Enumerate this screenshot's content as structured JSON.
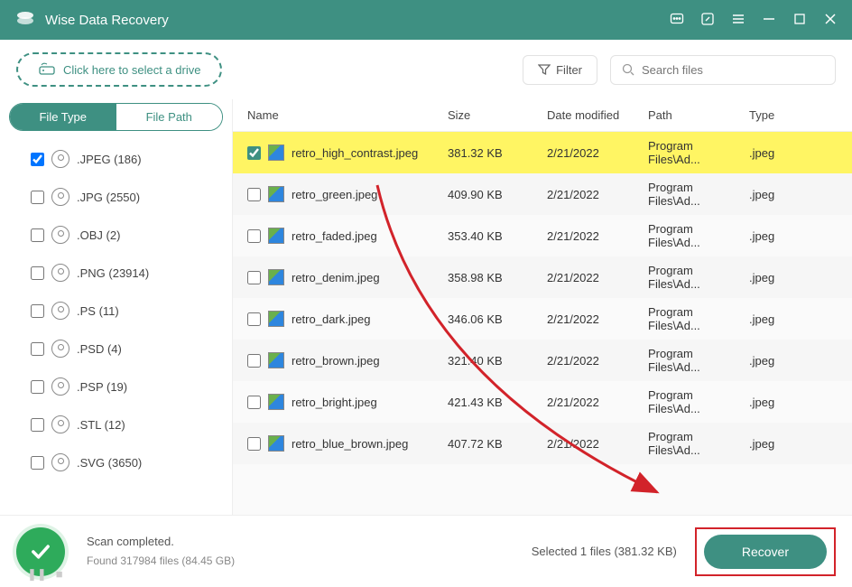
{
  "app": {
    "title": "Wise Data Recovery"
  },
  "topbar": {
    "drive_hint": "Click here to select a drive",
    "filter_label": "Filter",
    "search_placeholder": "Search files"
  },
  "tabs": {
    "file_type": "File Type",
    "file_path": "File Path"
  },
  "typeList": [
    {
      "label": ".JPEG (186)",
      "checked": true
    },
    {
      "label": ".JPG (2550)",
      "checked": false
    },
    {
      "label": ".OBJ (2)",
      "checked": false
    },
    {
      "label": ".PNG (23914)",
      "checked": false
    },
    {
      "label": ".PS (11)",
      "checked": false
    },
    {
      "label": ".PSD (4)",
      "checked": false
    },
    {
      "label": ".PSP (19)",
      "checked": false
    },
    {
      "label": ".STL (12)",
      "checked": false
    },
    {
      "label": ".SVG (3650)",
      "checked": false
    }
  ],
  "columns": {
    "name": "Name",
    "size": "Size",
    "date": "Date modified",
    "path": "Path",
    "type": "Type"
  },
  "files": [
    {
      "name": "retro_high_contrast.jpeg",
      "size": "381.32 KB",
      "date": "2/21/2022",
      "path": "Program Files\\Ad...",
      "type": ".jpeg",
      "checked": true,
      "selected": true
    },
    {
      "name": "retro_green.jpeg",
      "size": "409.90 KB",
      "date": "2/21/2022",
      "path": "Program Files\\Ad...",
      "type": ".jpeg",
      "checked": false,
      "selected": false
    },
    {
      "name": "retro_faded.jpeg",
      "size": "353.40 KB",
      "date": "2/21/2022",
      "path": "Program Files\\Ad...",
      "type": ".jpeg",
      "checked": false,
      "selected": false
    },
    {
      "name": "retro_denim.jpeg",
      "size": "358.98 KB",
      "date": "2/21/2022",
      "path": "Program Files\\Ad...",
      "type": ".jpeg",
      "checked": false,
      "selected": false
    },
    {
      "name": "retro_dark.jpeg",
      "size": "346.06 KB",
      "date": "2/21/2022",
      "path": "Program Files\\Ad...",
      "type": ".jpeg",
      "checked": false,
      "selected": false
    },
    {
      "name": "retro_brown.jpeg",
      "size": "321.40 KB",
      "date": "2/21/2022",
      "path": "Program Files\\Ad...",
      "type": ".jpeg",
      "checked": false,
      "selected": false
    },
    {
      "name": "retro_bright.jpeg",
      "size": "421.43 KB",
      "date": "2/21/2022",
      "path": "Program Files\\Ad...",
      "type": ".jpeg",
      "checked": false,
      "selected": false
    },
    {
      "name": "retro_blue_brown.jpeg",
      "size": "407.72 KB",
      "date": "2/21/2022",
      "path": "Program Files\\Ad...",
      "type": ".jpeg",
      "checked": false,
      "selected": false
    }
  ],
  "footer": {
    "status_title": "Scan completed.",
    "status_detail": "Found 317984 files (84.45 GB)",
    "selected_text": "Selected 1 files (381.32 KB)",
    "recover_label": "Recover"
  },
  "colors": {
    "accent": "#3e9082",
    "highlight": "#fff563",
    "arrow": "#d2232a"
  }
}
